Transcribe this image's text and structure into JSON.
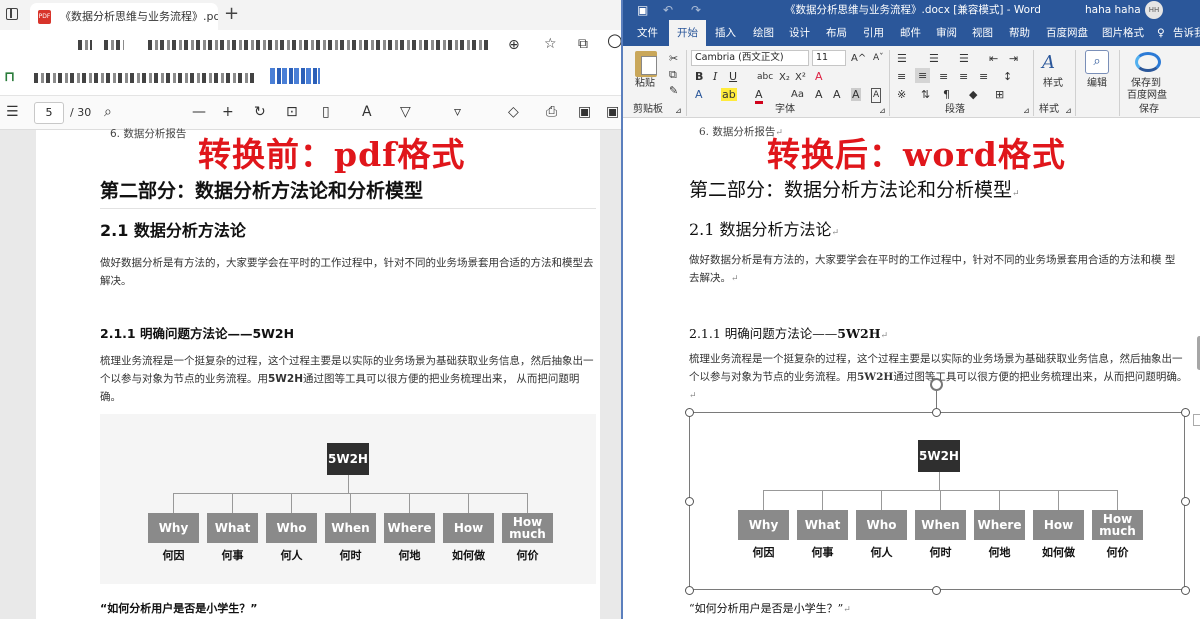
{
  "browser": {
    "tab_title": "《数据分析思维与业务流程》.pd",
    "tab_close": "✕",
    "new_tab": "+",
    "pdf_badge": "PDF"
  },
  "pdf_toolbar": {
    "current_page": "5",
    "page_total": "/ 30"
  },
  "left_doc": {
    "list_item": "6.  数据分析报告",
    "banner": "转换前：pdf格式",
    "part_title": "第二部分：数据分析方法论和分析模型",
    "section_title": "2.1 数据分析方法论",
    "section_body": "做好数据分析是有方法的，大家要学会在平时的工作过程中，针对不同的业务场景套用合适的方法和模型去解决。",
    "sub_title": "2.1.1 明确问题方法论——5W2H",
    "sub_body_a": "梳理业务流程是一个挺复杂的过程，这个过程主要是以实际的业务场景为基础获取业务信息，然后抽象出一个以参与对象为节点的业务流程。用",
    "sub_body_bold": "5W2H",
    "sub_body_b": "通过图等工具可以很方便的把业务梳理出来， 从而把问题明确。",
    "quote": "“如何分析用户是否是小学生？”"
  },
  "word": {
    "title": "《数据分析思维与业务流程》.docx [兼容模式] - Word",
    "user": "haha haha",
    "avatar": "HH",
    "tabs": [
      "文件",
      "开始",
      "插入",
      "绘图",
      "设计",
      "布局",
      "引用",
      "邮件",
      "审阅",
      "视图",
      "帮助",
      "百度网盘",
      "图片格式"
    ],
    "tell_me": "告诉我",
    "font_name": "Cambria (西文正文)",
    "font_size": "11",
    "groups": {
      "clipboard": "剪贴板",
      "font": "字体",
      "paragraph": "段落",
      "styles": "样式",
      "save": "保存"
    },
    "buttons": {
      "paste": "粘贴",
      "styles": "样式",
      "edit": "编辑",
      "save_to_cloud_1": "保存到",
      "save_to_cloud_2": "百度网盘"
    }
  },
  "right_doc": {
    "list_item": "6. 数据分析报告",
    "banner": "转换后：word格式",
    "part_title": "第二部分：数据分析方法论和分析模型",
    "section_title": "2.1 数据分析方法论",
    "section_body": "做好数据分析是有方法的，大家要学会在平时的工作过程中，针对不同的业务场景套用合适的方法和模 型去解决。",
    "sub_title_a": "2.1.1 明确问题方法论——",
    "sub_title_b": "5W2H",
    "sub_body_a": "梳理业务流程是一个挺复杂的过程，这个过程主要是以实际的业务场景为基础获取业务信息，然后抽象出一个以参与对象为节点的业务流程。用",
    "sub_body_bold": "5W2H",
    "sub_body_b": "通过图等工具可以很方便的把业务梳理出来，从而把问题明确。",
    "quote": "“如何分析用户是否是小学生？”",
    "para_mark": "↵"
  },
  "diagram": {
    "root": "5W2H",
    "nodes": [
      {
        "label": "Why",
        "caption": "何因"
      },
      {
        "label": "What",
        "caption": "何事"
      },
      {
        "label": "Who",
        "caption": "何人"
      },
      {
        "label": "When",
        "caption": "何时"
      },
      {
        "label": "Where",
        "caption": "何地"
      },
      {
        "label": "How",
        "caption": "如何做"
      },
      {
        "label": "How much",
        "caption": "何价"
      }
    ]
  }
}
